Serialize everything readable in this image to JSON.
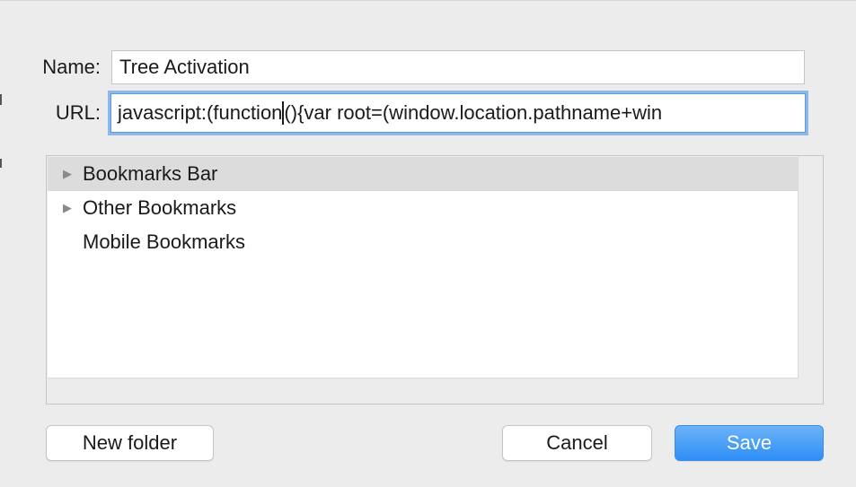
{
  "form": {
    "name_label": "Name:",
    "name_value": "Tree Activation",
    "url_label": "URL:",
    "url_value_before_caret": "javascript:(function",
    "url_value_after_caret": "(){var root=(window.location.pathname+win"
  },
  "folders": [
    {
      "label": "Bookmarks Bar",
      "expandable": true,
      "selected": true
    },
    {
      "label": "Other Bookmarks",
      "expandable": true,
      "selected": false
    },
    {
      "label": "Mobile Bookmarks",
      "expandable": false,
      "selected": false
    }
  ],
  "buttons": {
    "new_folder": "New folder",
    "cancel": "Cancel",
    "save": "Save"
  },
  "icons": {
    "disclosure": "▶"
  },
  "colors": {
    "accent": "#2e8ef5",
    "focus_ring": "#8fb8ea",
    "selection": "#dcdcdc"
  }
}
